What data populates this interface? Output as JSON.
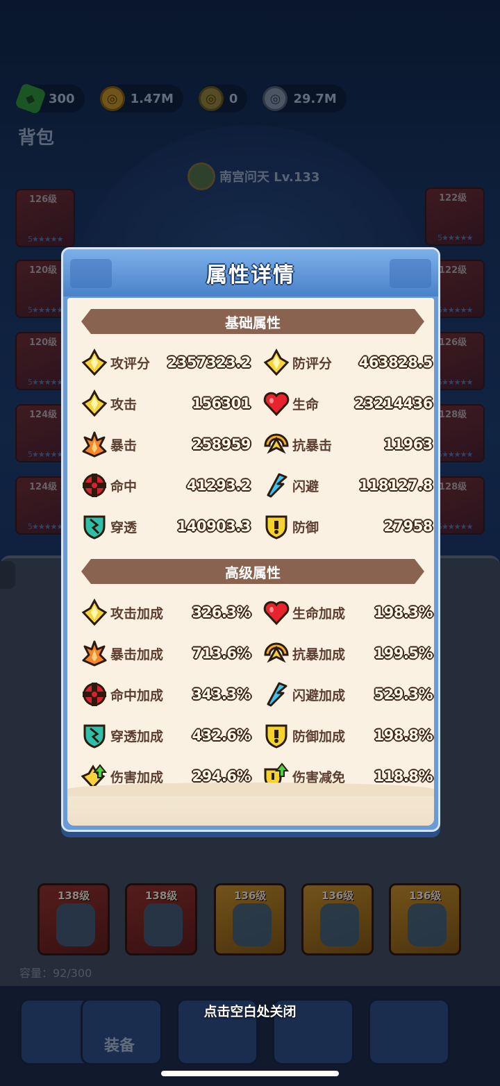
{
  "currency": [
    {
      "icon": "gem-icon",
      "value": "300"
    },
    {
      "icon": "gold-coin-icon",
      "value": "1.47M"
    },
    {
      "icon": "token-icon",
      "value": "0"
    },
    {
      "icon": "silver-coin-icon",
      "value": "29.7M"
    }
  ],
  "bag_title": "背包",
  "hero": {
    "name": "南宫问天 Lv.133"
  },
  "left_slots": [
    {
      "level": "126级",
      "stars": "5★★★★★"
    },
    {
      "level": "120级",
      "stars": "5★★★★★"
    },
    {
      "level": "120级",
      "stars": "5★★★★★"
    },
    {
      "level": "124级",
      "stars": "5★★★★★"
    },
    {
      "level": "124级",
      "stars": "5★★★★★"
    }
  ],
  "right_slots": [
    {
      "level": "122级",
      "stars": "5★★★★★"
    },
    {
      "level": "122级",
      "stars": "5★★★★★"
    },
    {
      "level": "126级",
      "stars": "5★★★★★"
    },
    {
      "level": "128级",
      "stars": "5★★★★★"
    },
    {
      "level": "128级",
      "stars": "5★★★★★"
    }
  ],
  "inventory_bottom_row": [
    {
      "level": "138级"
    },
    {
      "level": "138级"
    },
    {
      "level": "136级"
    },
    {
      "level": "136级"
    },
    {
      "level": "136级"
    }
  ],
  "capacity": "容量：92/300",
  "nav_label": "装备",
  "modal": {
    "title": "属性详情",
    "basic_section": "基础属性",
    "advanced_section": "高级属性",
    "basic_stats": [
      {
        "icon": "attack-score-icon",
        "label": "攻评分",
        "value": "2357323.2"
      },
      {
        "icon": "defense-score-icon",
        "label": "防评分",
        "value": "463828.5"
      },
      {
        "icon": "attack-icon",
        "label": "攻击",
        "value": "156301"
      },
      {
        "icon": "heart-icon",
        "label": "生命",
        "value": "23214436"
      },
      {
        "icon": "crit-icon",
        "label": "暴击",
        "value": "258959"
      },
      {
        "icon": "anti-crit-icon",
        "label": "抗暴击",
        "value": "11963"
      },
      {
        "icon": "hit-icon",
        "label": "命中",
        "value": "41293.2"
      },
      {
        "icon": "dodge-icon",
        "label": "闪避",
        "value": "118127.8"
      },
      {
        "icon": "pierce-icon",
        "label": "穿透",
        "value": "140903.3"
      },
      {
        "icon": "shield-icon",
        "label": "防御",
        "value": "27958"
      }
    ],
    "advanced_stats": [
      {
        "icon": "attack-icon",
        "label": "攻击加成",
        "value": "326.3%"
      },
      {
        "icon": "heart-icon",
        "label": "生命加成",
        "value": "198.3%"
      },
      {
        "icon": "crit-icon",
        "label": "暴击加成",
        "value": "713.6%"
      },
      {
        "icon": "anti-crit-icon",
        "label": "抗暴加成",
        "value": "199.5%"
      },
      {
        "icon": "hit-icon",
        "label": "命中加成",
        "value": "343.3%"
      },
      {
        "icon": "dodge-icon",
        "label": "闪避加成",
        "value": "529.3%"
      },
      {
        "icon": "pierce-icon",
        "label": "穿透加成",
        "value": "432.6%"
      },
      {
        "icon": "shield-icon",
        "label": "防御加成",
        "value": "198.8%"
      },
      {
        "icon": "damage-bonus-icon",
        "label": "伤害加成",
        "value": "294.6%"
      },
      {
        "icon": "damage-reduction-icon",
        "label": "伤害减免",
        "value": "118.8%"
      }
    ]
  },
  "close_hint": "点击空白处关闭",
  "colors": {
    "section_bar": "#8a6250",
    "panel_bg": "#fbf1e2",
    "header_blue": "#4a82c8"
  }
}
